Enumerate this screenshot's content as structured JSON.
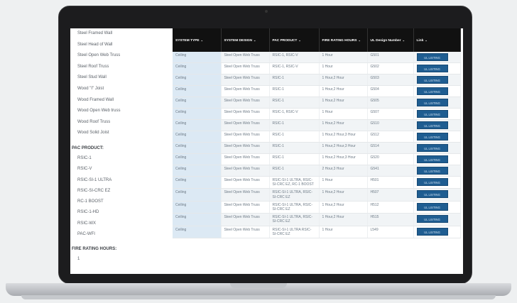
{
  "sidebar": {
    "design_items": [
      "Steel Framed Wall",
      "Steel Head of Wall",
      "Steel Open Web Truss",
      "Steel Roof Truss",
      "Steel Stud Wall",
      "Wood \"I\" Joist",
      "Wood Framed Wall",
      "Wood Open Web truss",
      "Wood Roof Truss",
      "Wood Solid Joist"
    ],
    "pac_heading": "PAC PRODUCT:",
    "pac_items": [
      "RSIC-1",
      "RSIC-V",
      "RSIC-SI-1 ULTRA",
      "RSIC-SI-CRC EZ",
      "RC-1 BOOST",
      "RSIC-1-HD",
      "RSIC-WX",
      "PAC-WFI"
    ],
    "fire_heading": "FIRE RATING HOURS:",
    "fire_items": [
      "1"
    ]
  },
  "table": {
    "headers": [
      "SYSTEM TYPE",
      "SYSTEM DESIGN",
      "PAC PRODUCT",
      "FIRE RATING HOURS",
      "UL Design Number",
      "Link"
    ],
    "sort_glyph": "⌄",
    "button_label": "UL LISTING",
    "rows": [
      [
        "Ceiling",
        "Steel Open Web Truss",
        "RSIC-1, RSIC-V",
        "1 Hour",
        "G501"
      ],
      [
        "Ceiling",
        "Steel Open Web Truss",
        "RSIC-1, RSIC-V",
        "1 Hour",
        "G502"
      ],
      [
        "Ceiling",
        "Steel Open Web Truss",
        "RSIC-1",
        "1 Hour,2 Hour",
        "G503"
      ],
      [
        "Ceiling",
        "Steel Open Web Truss",
        "RSIC-1",
        "1 Hour,2 Hour",
        "G504"
      ],
      [
        "Ceiling",
        "Steel Open Web Truss",
        "RSIC-1",
        "1 Hour,2 Hour",
        "G505"
      ],
      [
        "Ceiling",
        "Steel Open Web Truss",
        "RSIC-1, RSIC-V",
        "1 Hour",
        "G507"
      ],
      [
        "Ceiling",
        "Steel Open Web Truss",
        "RSIC-1",
        "1 Hour,2 Hour",
        "G510"
      ],
      [
        "Ceiling",
        "Steel Open Web Truss",
        "RSIC-1",
        "1 Hour,2 Hour,3 Hour",
        "G512"
      ],
      [
        "Ceiling",
        "Steel Open Web Truss",
        "RSIC-1",
        "1 Hour,2 Hour,3 Hour",
        "G514"
      ],
      [
        "Ceiling",
        "Steel Open Web Truss",
        "RSIC-1",
        "1 Hour,2 Hour,3 Hour",
        "G520"
      ],
      [
        "Ceiling",
        "Steel Open Web Truss",
        "RSIC-1",
        "2 Hour,3 Hour",
        "G541"
      ],
      [
        "Ceiling",
        "Steel Open Web Truss",
        "RSIC-SI-1 ULTRA, RSIC-SI-CRC EZ, RC-1 BOOST",
        "1 Hour",
        "H501"
      ],
      [
        "Ceiling",
        "Steel Open Web Truss",
        "RSIC-SI-1 ULTRA, RSIC-SI-CRC EZ",
        "1 Hour,2 Hour",
        "H507"
      ],
      [
        "Ceiling",
        "Steel Open Web Truss",
        "RSIC-SI-1 ULTRA, RSIC-SI-CRC EZ",
        "1 Hour,2 Hour",
        "H512"
      ],
      [
        "Ceiling",
        "Steel Open Web Truss",
        "RSIC-SI-1 ULTRA, RSIC-SI-CRC EZ",
        "1 Hour,2 Hour",
        "H515"
      ],
      [
        "Ceiling",
        "Steel Open Web Truss",
        "RSIC-SI-1 ULTRA RSIC-SI-CRC EZ",
        "1 Hour",
        "L549"
      ]
    ]
  }
}
